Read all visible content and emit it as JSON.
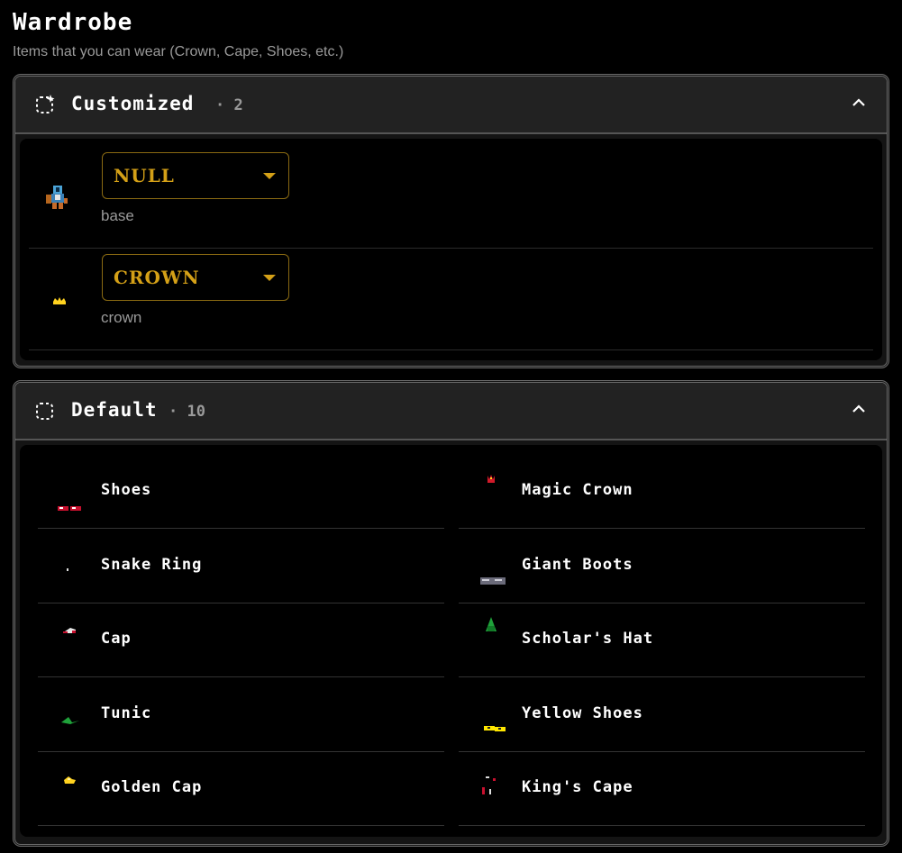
{
  "header": {
    "title": "Wardrobe",
    "subtitle": "Items that you can wear (Crown, Cape, Shoes, etc.)"
  },
  "customized": {
    "title": "Customized",
    "count": "· 2",
    "rows": [
      {
        "value": "NULL",
        "label": "base",
        "icon": "knight-sprite-icon"
      },
      {
        "value": "CROWN",
        "label": "crown",
        "icon": "crown-sprite-icon"
      }
    ]
  },
  "default": {
    "title": "Default",
    "count": "· 10",
    "items": [
      {
        "name": "Shoes",
        "icon": "shoes-sprite-icon"
      },
      {
        "name": "Magic Crown",
        "icon": "magic-crown-sprite-icon"
      },
      {
        "name": "Snake Ring",
        "icon": "snake-ring-sprite-icon"
      },
      {
        "name": "Giant Boots",
        "icon": "giant-boots-sprite-icon"
      },
      {
        "name": "Cap",
        "icon": "cap-sprite-icon"
      },
      {
        "name": "Scholar's Hat",
        "icon": "scholars-hat-sprite-icon"
      },
      {
        "name": "Tunic",
        "icon": "tunic-sprite-icon"
      },
      {
        "name": "Yellow Shoes",
        "icon": "yellow-shoes-sprite-icon"
      },
      {
        "name": "Golden Cap",
        "icon": "golden-cap-sprite-icon"
      },
      {
        "name": "King's Cape",
        "icon": "kings-cape-sprite-icon"
      }
    ]
  },
  "colors": {
    "accent": "#d4a017",
    "panel_header": "#222222",
    "muted_text": "#9a9a9a"
  }
}
